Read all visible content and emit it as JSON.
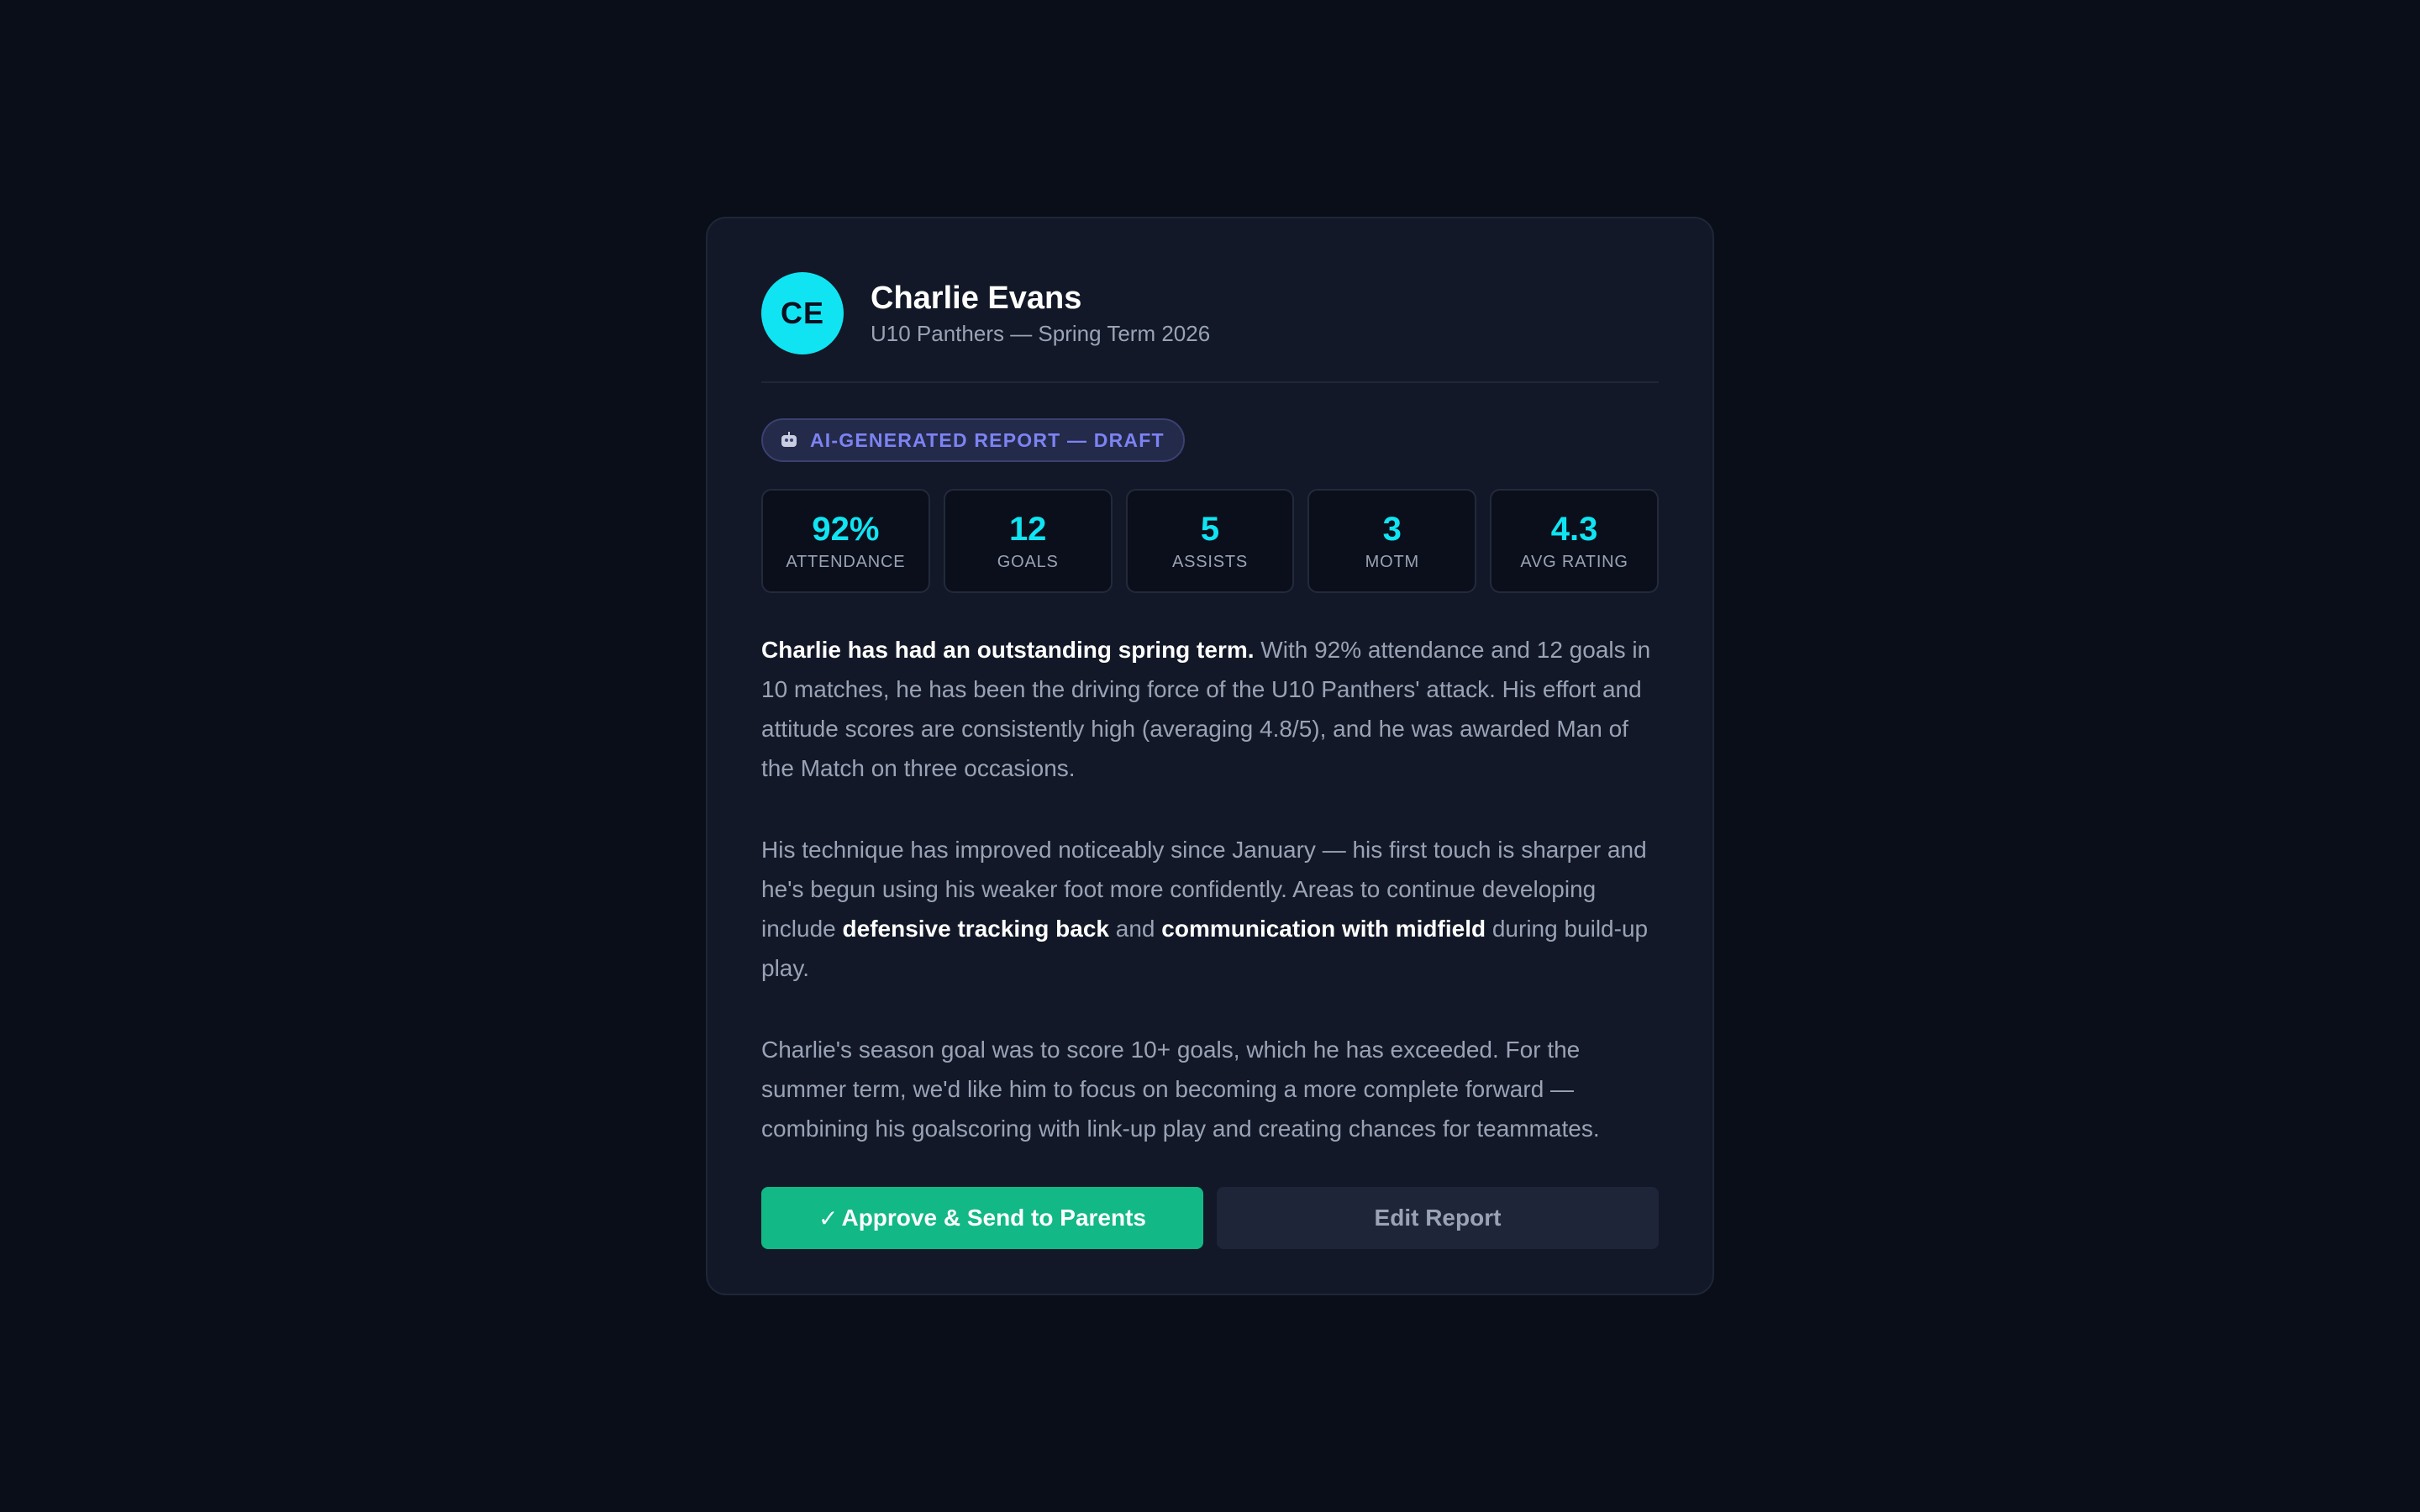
{
  "player": {
    "initials": "CE",
    "name": "Charlie Evans",
    "subtitle": "U10 Panthers — Spring Term 2026"
  },
  "badge": {
    "icon": "robot-icon",
    "label": "AI-GENERATED REPORT — DRAFT"
  },
  "stats": [
    {
      "value": "92%",
      "label": "ATTENDANCE"
    },
    {
      "value": "12",
      "label": "GOALS"
    },
    {
      "value": "5",
      "label": "ASSISTS"
    },
    {
      "value": "3",
      "label": "MOTM"
    },
    {
      "value": "4.3",
      "label": "AVG RATING"
    }
  ],
  "report": {
    "p1_bold": "Charlie has had an outstanding spring term.",
    "p1_rest": " With 92% attendance and 12 goals in 10 matches, he has been the driving force of the U10 Panthers' attack. His effort and attitude scores are consistently high (averaging 4.8/5), and he was awarded Man of the Match on three occasions.",
    "p2_a": "His technique has improved noticeably since January — his first touch is sharper and he's begun using his weaker foot more confidently. Areas to continue developing include ",
    "p2_bold1": "defensive tracking back",
    "p2_b": " and ",
    "p2_bold2": "communication with midfield",
    "p2_c": " during build-up play.",
    "p3": "Charlie's season goal was to score 10+ goals, which he has exceeded. For the summer term, we'd like him to focus on becoming a more complete forward — combining his goalscoring with link-up play and creating chances for teammates."
  },
  "actions": {
    "approve_icon": "✓",
    "approve_label": "Approve & Send to Parents",
    "edit_label": "Edit Report"
  },
  "colors": {
    "accent": "#10e4f2",
    "approve": "#12b886",
    "badge": "#7c83f2",
    "background": "#0a0e18",
    "card": "#121827"
  }
}
